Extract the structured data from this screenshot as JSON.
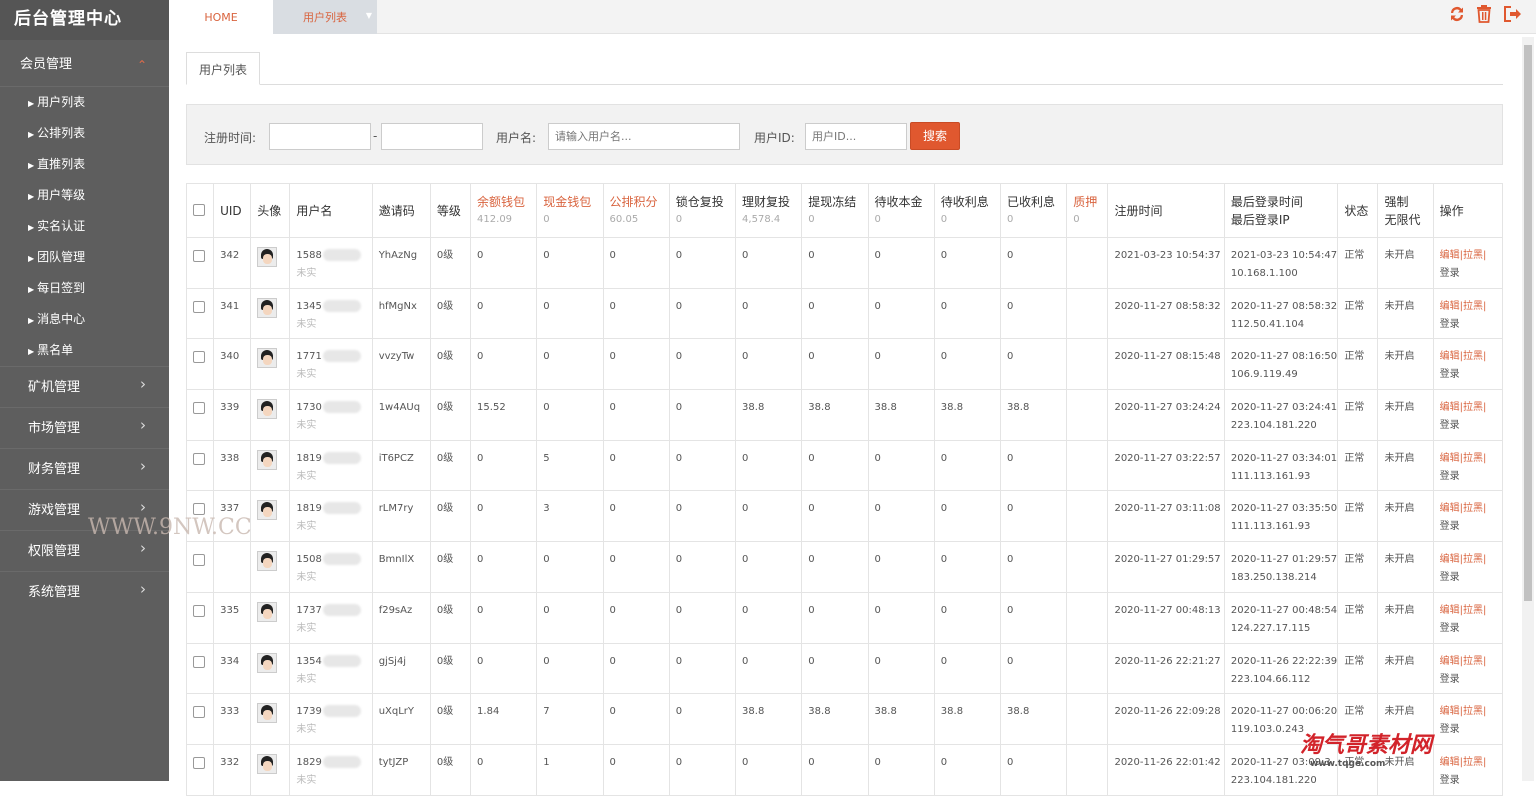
{
  "sidebar": {
    "brand": "后台管理中心",
    "top_menu": "会员管理",
    "top_arrow": "⌃",
    "sub_items": [
      "用户列表",
      "公排列表",
      "直推列表",
      "用户等级",
      "实名认证",
      "团队管理",
      "每日签到",
      "消息中心",
      "黑名单"
    ],
    "sections": [
      "矿机管理",
      "市场管理",
      "财务管理",
      "游戏管理",
      "权限管理",
      "系统管理"
    ]
  },
  "topbar": {
    "home_tab": "HOME",
    "active_tab": "用户列表",
    "icons": [
      "refresh-icon",
      "trash-icon",
      "logout-icon"
    ]
  },
  "content_tab": "用户列表",
  "search": {
    "reg_time_label": "注册时间:",
    "date_sep": "-",
    "username_label": "用户名:",
    "username_placeholder": "请输入用户名...",
    "uid_label": "用户ID:",
    "uid_placeholder": "用户ID...",
    "button": "搜索"
  },
  "table": {
    "headers": {
      "uid": "UID",
      "avatar": "头像",
      "username": "用户名",
      "invite": "邀请码",
      "level": "等级",
      "balance": "余额钱包",
      "balance_sum": "412.09",
      "cash": "现金钱包",
      "cash_sum": "0",
      "points": "公排积分",
      "points_sum": "60.05",
      "lock": "锁仓复投",
      "lock_sum": "0",
      "finance": "理财复投",
      "finance_sum": "4,578.4",
      "freeze": "提现冻结",
      "freeze_sum": "0",
      "pending_principal": "待收本金",
      "pending_principal_sum": "0",
      "pending_interest": "待收利息",
      "pending_interest_sum": "0",
      "received_interest": "已收利息",
      "received_interest_sum": "0",
      "pledge": "质押",
      "pledge_sum": "0",
      "reg_time": "注册时间",
      "last_login_time": "最后登录时间",
      "last_login_ip": "最后登录IP",
      "status": "状态",
      "force_1": "强制",
      "force_2": "无限代",
      "ops": "操作"
    },
    "rows": [
      {
        "uid": "342",
        "phone": "1588",
        "unverified": "未实",
        "invite": "YhAzNg",
        "level": "0级",
        "balance": "0",
        "cash": "0",
        "points": "0",
        "lock": "0",
        "finance": "0",
        "freeze": "0",
        "pp": "0",
        "pi": "0",
        "ri": "0",
        "reg": "2021-03-23 10:54:37",
        "login": "2021-03-23 10:54:47",
        "ip": "10.168.1.100",
        "status": "正常",
        "force": "未开启",
        "edit": "编辑|",
        "black": "拉黑|",
        "login_op": "登录"
      },
      {
        "uid": "341",
        "phone": "1345",
        "unverified": "未实",
        "invite": "hfMgNx",
        "level": "0级",
        "balance": "0",
        "cash": "0",
        "points": "0",
        "lock": "0",
        "finance": "0",
        "freeze": "0",
        "pp": "0",
        "pi": "0",
        "ri": "0",
        "reg": "2020-11-27 08:58:32",
        "login": "2020-11-27 08:58:32",
        "ip": "112.50.41.104",
        "status": "正常",
        "force": "未开启",
        "edit": "编辑|",
        "black": "拉黑|",
        "login_op": "登录"
      },
      {
        "uid": "340",
        "phone": "1771",
        "unverified": "未实",
        "invite": "vvzyTw",
        "level": "0级",
        "balance": "0",
        "cash": "0",
        "points": "0",
        "lock": "0",
        "finance": "0",
        "freeze": "0",
        "pp": "0",
        "pi": "0",
        "ri": "0",
        "reg": "2020-11-27 08:15:48",
        "login": "2020-11-27 08:16:50",
        "ip": "106.9.119.49",
        "status": "正常",
        "force": "未开启",
        "edit": "编辑|",
        "black": "拉黑|",
        "login_op": "登录"
      },
      {
        "uid": "339",
        "phone": "1730",
        "unverified": "未实",
        "invite": "1w4AUq",
        "level": "0级",
        "balance": "15.52",
        "cash": "0",
        "points": "0",
        "lock": "0",
        "finance": "38.8",
        "freeze": "38.8",
        "pp": "38.8",
        "pi": "38.8",
        "ri": "38.8",
        "reg": "2020-11-27 03:24:24",
        "login": "2020-11-27 03:24:41",
        "ip": "223.104.181.220",
        "status": "正常",
        "force": "未开启",
        "edit": "编辑|",
        "black": "拉黑|",
        "login_op": "登录"
      },
      {
        "uid": "338",
        "phone": "1819",
        "unverified": "未实",
        "invite": "iT6PCZ",
        "level": "0级",
        "balance": "0",
        "cash": "5",
        "points": "0",
        "lock": "0",
        "finance": "0",
        "freeze": "0",
        "pp": "0",
        "pi": "0",
        "ri": "0",
        "reg": "2020-11-27 03:22:57",
        "login": "2020-11-27 03:34:01",
        "ip": "111.113.161.93",
        "status": "正常",
        "force": "未开启",
        "edit": "编辑|",
        "black": "拉黑|",
        "login_op": "登录"
      },
      {
        "uid": "337",
        "phone": "1819",
        "unverified": "未实",
        "invite": "rLM7ry",
        "level": "0级",
        "balance": "0",
        "cash": "3",
        "points": "0",
        "lock": "0",
        "finance": "0",
        "freeze": "0",
        "pp": "0",
        "pi": "0",
        "ri": "0",
        "reg": "2020-11-27 03:11:08",
        "login": "2020-11-27 03:35:50",
        "ip": "111.113.161.93",
        "status": "正常",
        "force": "未开启",
        "edit": "编辑|",
        "black": "拉黑|",
        "login_op": "登录"
      },
      {
        "uid": "",
        "phone": "1508",
        "unverified": "未实",
        "invite": "BmnIlX",
        "level": "0级",
        "balance": "0",
        "cash": "0",
        "points": "0",
        "lock": "0",
        "finance": "0",
        "freeze": "0",
        "pp": "0",
        "pi": "0",
        "ri": "0",
        "reg": "2020-11-27 01:29:57",
        "login": "2020-11-27 01:29:57",
        "ip": "183.250.138.214",
        "status": "正常",
        "force": "未开启",
        "edit": "编辑|",
        "black": "拉黑|",
        "login_op": "登录"
      },
      {
        "uid": "335",
        "phone": "1737",
        "unverified": "未实",
        "invite": "f29sAz",
        "level": "0级",
        "balance": "0",
        "cash": "0",
        "points": "0",
        "lock": "0",
        "finance": "0",
        "freeze": "0",
        "pp": "0",
        "pi": "0",
        "ri": "0",
        "reg": "2020-11-27 00:48:13",
        "login": "2020-11-27 00:48:54",
        "ip": "124.227.17.115",
        "status": "正常",
        "force": "未开启",
        "edit": "编辑|",
        "black": "拉黑|",
        "login_op": "登录"
      },
      {
        "uid": "334",
        "phone": "1354",
        "unverified": "未实",
        "invite": "gjSj4j",
        "level": "0级",
        "balance": "0",
        "cash": "0",
        "points": "0",
        "lock": "0",
        "finance": "0",
        "freeze": "0",
        "pp": "0",
        "pi": "0",
        "ri": "0",
        "reg": "2020-11-26 22:21:27",
        "login": "2020-11-26 22:22:39",
        "ip": "223.104.66.112",
        "status": "正常",
        "force": "未开启",
        "edit": "编辑|",
        "black": "拉黑|",
        "login_op": "登录"
      },
      {
        "uid": "333",
        "phone": "1739",
        "unverified": "未实",
        "invite": "uXqLrY",
        "level": "0级",
        "balance": "1.84",
        "cash": "7",
        "points": "0",
        "lock": "0",
        "finance": "38.8",
        "freeze": "38.8",
        "pp": "38.8",
        "pi": "38.8",
        "ri": "38.8",
        "reg": "2020-11-26 22:09:28",
        "login": "2020-11-27 00:06:20",
        "ip": "119.103.0.243",
        "status": "正常",
        "force": "未开启",
        "edit": "编辑|",
        "black": "拉黑|",
        "login_op": "登录"
      },
      {
        "uid": "332",
        "phone": "1829",
        "unverified": "未实",
        "invite": "tytJZP",
        "level": "0级",
        "balance": "0",
        "cash": "1",
        "points": "0",
        "lock": "0",
        "finance": "0",
        "freeze": "0",
        "pp": "0",
        "pi": "0",
        "ri": "0",
        "reg": "2020-11-26 22:01:42",
        "login": "2020-11-27 03:09:3",
        "ip": "223.104.181.220",
        "status": "正常",
        "force": "未开启",
        "edit": "编辑|",
        "black": "拉黑|",
        "login_op": "登录"
      }
    ]
  },
  "watermark": {
    "site": "WWW.9NW.CC",
    "brand": "淘气哥素材网",
    "url": "www.tqge.com"
  }
}
